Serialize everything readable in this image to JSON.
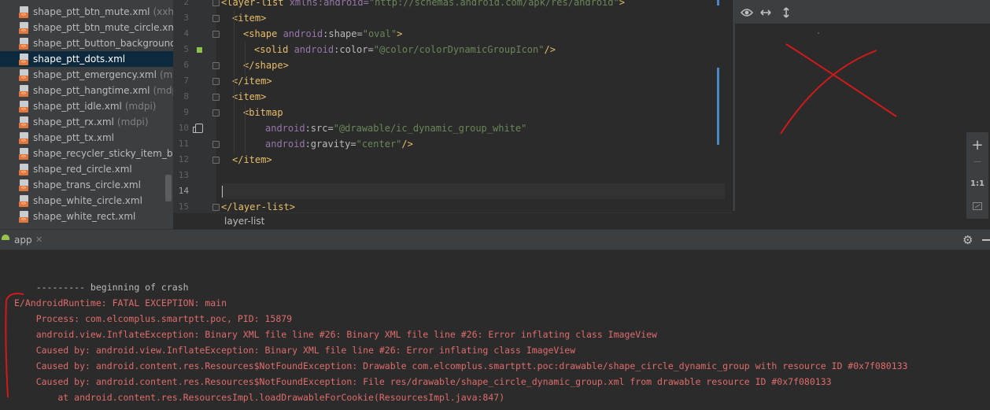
{
  "project_tree": {
    "items": [
      {
        "name": "shape_ptt_btn_mute.xml",
        "qualifier": "(xxhdpi)"
      },
      {
        "name": "shape_ptt_btn_mute_circle.xml",
        "qualifier": ""
      },
      {
        "name": "shape_ptt_button_background.xml",
        "qualifier": ""
      },
      {
        "name": "shape_ptt_dots.xml",
        "qualifier": "",
        "selected": true
      },
      {
        "name": "shape_ptt_emergency.xml",
        "qualifier": "(mdpi)"
      },
      {
        "name": "shape_ptt_hangtime.xml",
        "qualifier": "(mdpi)"
      },
      {
        "name": "shape_ptt_idle.xml",
        "qualifier": "(mdpi)"
      },
      {
        "name": "shape_ptt_rx.xml",
        "qualifier": "(mdpi)"
      },
      {
        "name": "shape_ptt_tx.xml",
        "qualifier": ""
      },
      {
        "name": "shape_recycler_sticky_item_background.xml",
        "qualifier": ""
      },
      {
        "name": "shape_red_circle.xml",
        "qualifier": ""
      },
      {
        "name": "shape_trans_circle.xml",
        "qualifier": ""
      },
      {
        "name": "shape_white_circle.xml",
        "qualifier": ""
      },
      {
        "name": "shape_white_rect.xml",
        "qualifier": ""
      }
    ],
    "file_icon_tag": "<>"
  },
  "editor": {
    "line_numbers": [
      "2",
      "3",
      "4",
      "5",
      "6",
      "7",
      "8",
      "9",
      "10",
      "11",
      "12",
      "13",
      "14",
      "15"
    ],
    "code": {
      "l2": {
        "open": "<layer-list ",
        "attr_ns": "xmlns:",
        "attr": "android=",
        "val": "\"http://schemas.android.com/apk/res/android\"",
        "close": ">"
      },
      "l3": "<item>",
      "l4": {
        "open": "<shape ",
        "ns": "android",
        "attr": ":shape=",
        "val": "\"oval\"",
        "close": ">"
      },
      "l5": {
        "open": "<solid ",
        "ns": "android",
        "attr": ":color=",
        "val": "\"@color/colorDynamicGroupIcon\"",
        "close": "/>"
      },
      "l6": "</shape>",
      "l7": "</item>",
      "l8": "<item>",
      "l9": "<bitmap",
      "l10": {
        "ns": "android",
        "attr": ":src=",
        "val": "\"@drawable/ic_dynamic_group_white\""
      },
      "l11": {
        "ns": "android",
        "attr": ":gravity=",
        "val": "\"center\"",
        "close": "/>"
      },
      "l12": "</item>",
      "l15": "</layer-list>"
    },
    "breadcrumb": "layer-list",
    "colors": {
      "swatch": "#8bc34a"
    }
  },
  "preview": {
    "toolbar_icons": [
      "eye-icon",
      "fit-width-icon",
      "fit-height-icon"
    ],
    "zoom": {
      "in": "+",
      "out": "—",
      "actual": "1:1",
      "fit": "fit-screen-icon"
    }
  },
  "run_panel": {
    "tab_label": "app",
    "tab_close": "✕"
  },
  "console": {
    "lines": [
      {
        "text": "    --------- beginning of crash",
        "kind": "norm"
      },
      {
        "text": "E/AndroidRuntime: FATAL EXCEPTION: main",
        "kind": "err"
      },
      {
        "text": "    Process: com.elcomplus.smartptt.poc, PID: 15879",
        "kind": "err"
      },
      {
        "text": "    android.view.InflateException: Binary XML file line #26: Binary XML file line #26: Error inflating class ImageView",
        "kind": "err"
      },
      {
        "text": "    Caused by: android.view.InflateException: Binary XML file line #26: Error inflating class ImageView",
        "kind": "err"
      },
      {
        "text": "    Caused by: android.content.res.Resources$NotFoundException: Drawable com.elcomplus.smartptt.poc:drawable/shape_circle_dynamic_group with resource ID #0x7f080133",
        "kind": "err"
      },
      {
        "text": "    Caused by: android.content.res.Resources$NotFoundException: File res/drawable/shape_circle_dynamic_group.xml from drawable resource ID #0x7f080133",
        "kind": "err"
      },
      {
        "text": "        at android.content.res.ResourcesImpl.loadDrawableForCookie(ResourcesImpl.java:847)",
        "kind": "err"
      }
    ]
  }
}
